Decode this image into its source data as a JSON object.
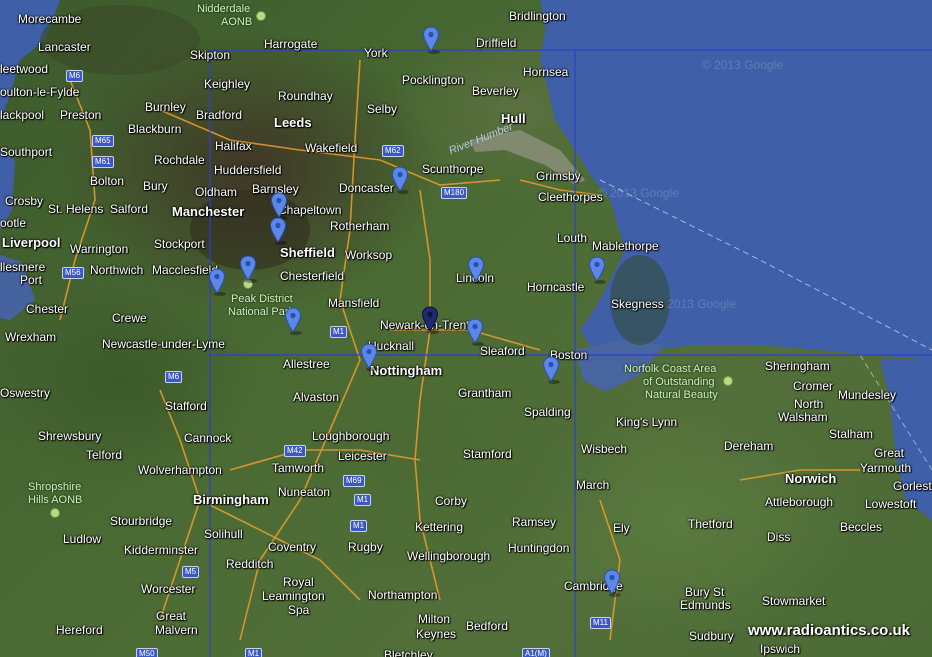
{
  "map": {
    "colors": {
      "sea": "#3f5fa8",
      "land": "#4a6a33",
      "grid": "#2f3fcf",
      "pin_light": "#5c87e6",
      "pin_dark": "#1d2a6e",
      "road": "#e39a2c"
    },
    "watermarks": [
      "© 2013 Google",
      "© 2013 Google",
      "© 2013 Google"
    ],
    "places": [
      {
        "name": "Morecambe"
      },
      {
        "name": "Lancaster"
      },
      {
        "name": "leetwood"
      },
      {
        "name": "oulton-le-Fylde"
      },
      {
        "name": "lackpool"
      },
      {
        "name": "Preston"
      },
      {
        "name": "Southport"
      },
      {
        "name": "Crosby"
      },
      {
        "name": "ootle"
      },
      {
        "name": "Liverpool"
      },
      {
        "name": "llesmere"
      },
      {
        "name": "Port"
      },
      {
        "name": "Chester"
      },
      {
        "name": "Wrexham"
      },
      {
        "name": "Burnley"
      },
      {
        "name": "Blackburn"
      },
      {
        "name": "Rochdale"
      },
      {
        "name": "Bolton"
      },
      {
        "name": "Bury"
      },
      {
        "name": "Oldham"
      },
      {
        "name": "St. Helens"
      },
      {
        "name": "Salford"
      },
      {
        "name": "Manchester"
      },
      {
        "name": "Warrington"
      },
      {
        "name": "Stockport"
      },
      {
        "name": "Northwich"
      },
      {
        "name": "Macclesfield"
      },
      {
        "name": "Crewe"
      },
      {
        "name": "Newcastle-under-Lyme"
      },
      {
        "name": "Skipton"
      },
      {
        "name": "Keighley"
      },
      {
        "name": "Bradford"
      },
      {
        "name": "Halifax"
      },
      {
        "name": "Huddersfield"
      },
      {
        "name": "Barnsley"
      },
      {
        "name": "Leeds"
      },
      {
        "name": "Harrogate"
      },
      {
        "name": "Roundhay"
      },
      {
        "name": "Wakefield"
      },
      {
        "name": "York"
      },
      {
        "name": "Selby"
      },
      {
        "name": "Pocklington"
      },
      {
        "name": "Driffield"
      },
      {
        "name": "Bridlington"
      },
      {
        "name": "Hornsea"
      },
      {
        "name": "Beverley"
      },
      {
        "name": "Hull"
      },
      {
        "name": "Scunthorpe"
      },
      {
        "name": "Doncaster"
      },
      {
        "name": "Grimsby"
      },
      {
        "name": "Cleethorpes"
      },
      {
        "name": "Louth"
      },
      {
        "name": "Mablethorpe"
      },
      {
        "name": "Chapeltown"
      },
      {
        "name": "Rotherham"
      },
      {
        "name": "Sheffield"
      },
      {
        "name": "Worksop"
      },
      {
        "name": "Chesterfield"
      },
      {
        "name": "Mansfield"
      },
      {
        "name": "Lincoln"
      },
      {
        "name": "Horncastle"
      },
      {
        "name": "Skegness"
      },
      {
        "name": "Newark-on-Trent"
      },
      {
        "name": "Sleaford"
      },
      {
        "name": "Boston"
      },
      {
        "name": "Hucknall"
      },
      {
        "name": "Nottingham"
      },
      {
        "name": "Allestree"
      },
      {
        "name": "Alvaston"
      },
      {
        "name": "Grantham"
      },
      {
        "name": "Spalding"
      },
      {
        "name": "Sheringham"
      },
      {
        "name": "Cromer"
      },
      {
        "name": "North"
      },
      {
        "name": "Walsham"
      },
      {
        "name": "Mundesley"
      },
      {
        "name": "King's Lynn"
      },
      {
        "name": "Dereham"
      },
      {
        "name": "Stalham"
      },
      {
        "name": "Great"
      },
      {
        "name": "Yarmouth"
      },
      {
        "name": "Norwich"
      },
      {
        "name": "Gorlesto"
      },
      {
        "name": "Lowestoft"
      },
      {
        "name": "Wisbech"
      },
      {
        "name": "Attleborough"
      },
      {
        "name": "Beccles"
      },
      {
        "name": "March"
      },
      {
        "name": "Thetford"
      },
      {
        "name": "Diss"
      },
      {
        "name": "Ely"
      },
      {
        "name": "Cambridge"
      },
      {
        "name": "Bury St"
      },
      {
        "name": "Edmunds"
      },
      {
        "name": "Stowmarket"
      },
      {
        "name": "Sudbury"
      },
      {
        "name": "Ipswich"
      },
      {
        "name": "Stamford"
      },
      {
        "name": "Corby"
      },
      {
        "name": "Kettering"
      },
      {
        "name": "Ramsey"
      },
      {
        "name": "Huntingdon"
      },
      {
        "name": "Wellingborough"
      },
      {
        "name": "Northampton"
      },
      {
        "name": "Milton"
      },
      {
        "name": "Keynes"
      },
      {
        "name": "Bedford"
      },
      {
        "name": "Bletchley"
      },
      {
        "name": "Loughborough"
      },
      {
        "name": "Leicester"
      },
      {
        "name": "Tamworth"
      },
      {
        "name": "Nuneaton"
      },
      {
        "name": "Coventry"
      },
      {
        "name": "Rugby"
      },
      {
        "name": "Royal"
      },
      {
        "name": "Leamington"
      },
      {
        "name": "Spa"
      },
      {
        "name": "Redditch"
      },
      {
        "name": "Solihull"
      },
      {
        "name": "Birmingham"
      },
      {
        "name": "Wolverhampton"
      },
      {
        "name": "Cannock"
      },
      {
        "name": "Stafford"
      },
      {
        "name": "Telford"
      },
      {
        "name": "Shrewsbury"
      },
      {
        "name": "Oswestry"
      },
      {
        "name": "Stourbridge"
      },
      {
        "name": "Kidderminster"
      },
      {
        "name": "Worcester"
      },
      {
        "name": "Great"
      },
      {
        "name": "Malvern"
      },
      {
        "name": "Hereford"
      },
      {
        "name": "Ludlow"
      }
    ],
    "areas": [
      {
        "name": "Nidderdale"
      },
      {
        "name": "AONB"
      },
      {
        "name": "Peak District"
      },
      {
        "name": "National Park"
      },
      {
        "name": "Norfolk Coast Area"
      },
      {
        "name": "of Outstanding"
      },
      {
        "name": "Natural Beauty"
      },
      {
        "name": "Shropshire"
      },
      {
        "name": "Hills AONB"
      }
    ],
    "water_labels": [
      {
        "name": "River Humber"
      }
    ],
    "road_shields": [
      "M6",
      "M65",
      "M61",
      "M56",
      "M62",
      "M180",
      "M1",
      "M6",
      "M42",
      "M69",
      "M1",
      "M1",
      "M5",
      "M11",
      "M50",
      "A1(M)",
      "M1"
    ],
    "pins": [
      {
        "id": "pin-driffield",
        "style": "light"
      },
      {
        "id": "pin-doncaster",
        "style": "light"
      },
      {
        "id": "pin-penistone",
        "style": "light"
      },
      {
        "id": "pin-stocksbridge",
        "style": "light"
      },
      {
        "id": "pin-buxton",
        "style": "light"
      },
      {
        "id": "pin-macclesfield",
        "style": "light"
      },
      {
        "id": "pin-matlock",
        "style": "light"
      },
      {
        "id": "pin-lincoln",
        "style": "light"
      },
      {
        "id": "pin-newark",
        "style": "dark"
      },
      {
        "id": "pin-sleaford",
        "style": "light"
      },
      {
        "id": "pin-hucknall",
        "style": "light"
      },
      {
        "id": "pin-boston",
        "style": "light"
      },
      {
        "id": "pin-mablethorpe",
        "style": "light"
      },
      {
        "id": "pin-cambridge",
        "style": "light"
      }
    ],
    "footer": "www.radioantics.co.uk"
  }
}
